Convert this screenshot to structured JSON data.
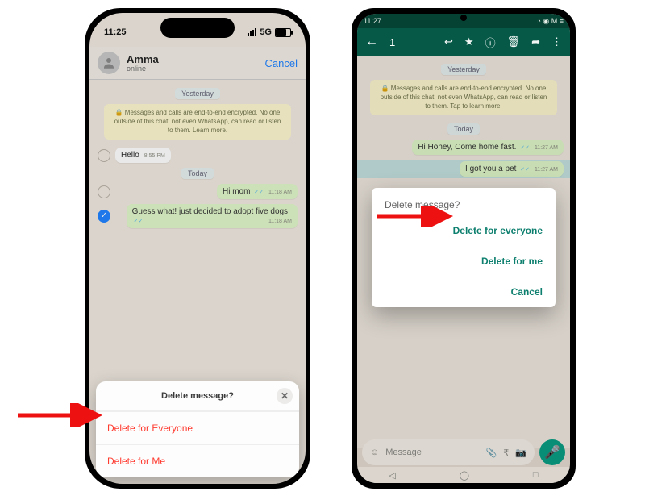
{
  "iphone": {
    "status": {
      "time": "11:25",
      "carrier_icon": "signal",
      "net": "5G",
      "battery_icon": "battery"
    },
    "header": {
      "name": "Amma",
      "subtitle": "online",
      "cancel": "Cancel"
    },
    "chat": {
      "day1": "Yesterday",
      "encryption": "🔒 Messages and calls are end-to-end encrypted. No one outside of this chat, not even WhatsApp, can read or listen to them. Learn more.",
      "msg1": {
        "text": "Hello",
        "time": "8:55 PM"
      },
      "day2": "Today",
      "msg2": {
        "text": "Hi mom",
        "time": "11:18 AM"
      },
      "msg3": {
        "text": "Guess what! just decided to adopt five dogs",
        "time": "11:18 AM"
      }
    },
    "sheet": {
      "title": "Delete message?",
      "opt1": "Delete for Everyone",
      "opt2": "Delete for Me"
    }
  },
  "android": {
    "status": {
      "time": "11:27",
      "icons": "◔ ◉ M ≡"
    },
    "header": {
      "selected_count": "1"
    },
    "chat": {
      "day1": "Yesterday",
      "encryption": "🔒 Messages and calls are end-to-end encrypted. No one outside of this chat, not even WhatsApp, can read or listen to them. Tap to learn more.",
      "day2": "Today",
      "msg1": {
        "text": "Hi Honey, Come home fast.",
        "time": "11:27 AM"
      },
      "msg2": {
        "text": "I got you a pet",
        "time": "11:27 AM"
      }
    },
    "dialog": {
      "title": "Delete message?",
      "opt1": "Delete for everyone",
      "opt2": "Delete for me",
      "opt3": "Cancel"
    },
    "input": {
      "emoji": "☺",
      "placeholder": "Message",
      "attach": "📎",
      "rupee": "₹",
      "camera": "📷",
      "mic": "🎤"
    }
  }
}
